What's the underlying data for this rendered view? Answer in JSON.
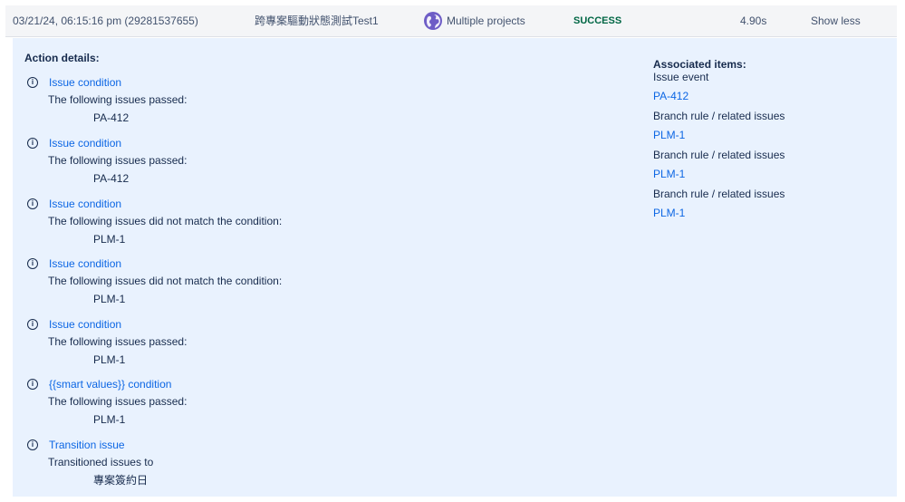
{
  "row": {
    "timestamp": "03/21/24, 06:15:16 pm (29281537655)",
    "rule_name": "跨專案驅動狀態測試Test1",
    "project_icon": "globe-icon",
    "project": "Multiple projects",
    "status": "SUCCESS",
    "status_color": "#006644",
    "duration": "4.90s",
    "toggle": "Show less"
  },
  "details": {
    "title": "Action details:",
    "actions": [
      {
        "title": "Issue condition",
        "desc": "The following issues passed:",
        "item": "PA-412"
      },
      {
        "title": "Issue condition",
        "desc": "The following issues passed:",
        "item": "PA-412"
      },
      {
        "title": "Issue condition",
        "desc": "The following issues did not match the condition:",
        "item": "PLM-1"
      },
      {
        "title": "Issue condition",
        "desc": "The following issues did not match the condition:",
        "item": "PLM-1"
      },
      {
        "title": "Issue condition",
        "desc": "The following issues passed:",
        "item": "PLM-1"
      },
      {
        "title": "{{smart values}} condition",
        "desc": "The following issues passed:",
        "item": "PLM-1"
      },
      {
        "title": "Transition issue",
        "desc": "Transitioned issues to",
        "item": "專案簽約日"
      }
    ]
  },
  "associated": {
    "title": "Associated items:",
    "groups": [
      {
        "label": "Issue event",
        "link": "PA-412"
      },
      {
        "label": "Branch rule / related issues",
        "link": "PLM-1"
      },
      {
        "label": "Branch rule / related issues",
        "link": "PLM-1"
      },
      {
        "label": "Branch rule / related issues",
        "link": "PLM-1"
      }
    ]
  },
  "colors": {
    "link": "#0c66e4",
    "panel_bg": "#e9f2fe"
  }
}
